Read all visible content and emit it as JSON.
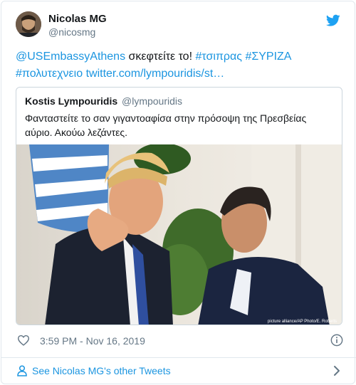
{
  "tweet": {
    "author_name": "Nicolas MG",
    "author_handle": "@nicosmg",
    "text_mention": "@USEmbassyAthens",
    "text_plain": " σκεφτείτε το! ",
    "hashtag_1": "#τσιπρας",
    "hashtag_2": "#ΣΥΡΙΖΑ",
    "hashtag_3": "#πολυτεχνειο",
    "link": "twitter.com/lympouridis/st…",
    "timestamp": "3:59 PM - Nov 16, 2019"
  },
  "quoted": {
    "author_name": "Kostis Lympouridis",
    "author_handle": "@lympouridis",
    "text": "Φανταστείτε το σαν γιγαντοαφίσα στην πρόσοψη της Πρεσβείας αύριο. Ακούω λεζάντες.",
    "photo_credit": "picture alliance/AP Photo/E. Roberts"
  },
  "footer": {
    "label": "See Nicolas MG's other Tweets"
  },
  "colors": {
    "link": "#1b95e0",
    "secondary_text": "#657786",
    "border": "#e1e8ed"
  },
  "icons": [
    "twitter-bird-icon",
    "heart-icon",
    "info-icon",
    "person-icon",
    "chevron-right-icon"
  ]
}
